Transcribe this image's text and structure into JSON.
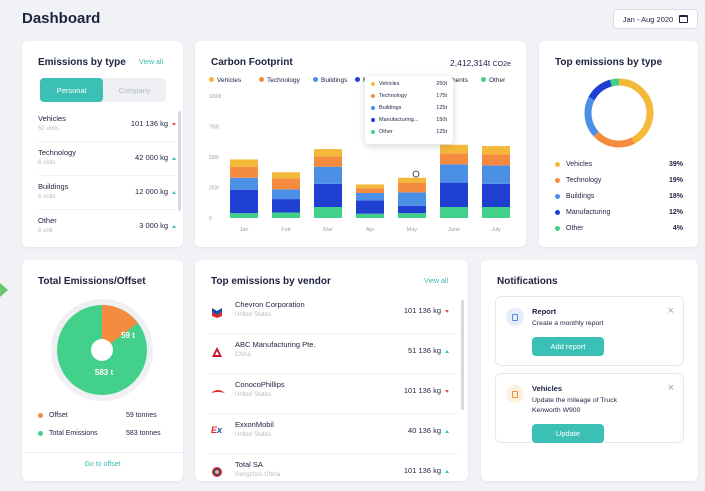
{
  "header": {
    "title": "Dashboard",
    "date_range": "Jan - Aug 2020"
  },
  "colors": {
    "vehicles": "#f5b93a",
    "technology": "#f58b3e",
    "buildings": "#4b8fe6",
    "manufacturing": "#1f3fd1",
    "other": "#43d08a",
    "accent": "#3cbfb4"
  },
  "emissions_by_type": {
    "title": "Emissions by type",
    "view_all": "View all",
    "tabs": [
      "Personal",
      "Company"
    ],
    "items": [
      {
        "name": "Vehicles",
        "units": "52 units",
        "value": "101 136 kg",
        "trend": "down"
      },
      {
        "name": "Technology",
        "units": "6 units",
        "value": "42 000 kg",
        "trend": "up"
      },
      {
        "name": "Buildings",
        "units": "6 units",
        "value": "12 000 kg",
        "trend": "up"
      },
      {
        "name": "Other",
        "units": "6 unit",
        "value": "3 000 kg",
        "trend": "up"
      }
    ]
  },
  "carbon_footprint": {
    "title": "Carbon Footprint",
    "total_value": "2,412,314t",
    "total_unit": "CO2e",
    "legend": [
      "Vehicles",
      "Technology",
      "Buildings",
      "Manufacturing",
      "Other"
    ],
    "legend_visible_tail": "hents",
    "tooltip": [
      {
        "name": "Vehicles",
        "value": "250t"
      },
      {
        "name": "Technology",
        "value": "175t"
      },
      {
        "name": "Buildings",
        "value": "125t"
      },
      {
        "name": "Manufacturing...",
        "value": "150t"
      },
      {
        "name": "Other",
        "value": "125t"
      }
    ]
  },
  "chart_data": {
    "type": "bar",
    "stacked": true,
    "categories": [
      "Jan",
      "Feb",
      "Mar",
      "Apr",
      "May",
      "June",
      "July"
    ],
    "yticks": [
      "1000t",
      "750t",
      "500t",
      "250t",
      "0"
    ],
    "ylim": [
      0,
      1000
    ],
    "series": [
      {
        "name": "Other",
        "values": [
          40,
          45,
          90,
          35,
          40,
          90,
          90
        ]
      },
      {
        "name": "Manufacturing",
        "values": [
          190,
          110,
          190,
          110,
          60,
          200,
          190
        ]
      },
      {
        "name": "Buildings",
        "values": [
          100,
          80,
          140,
          60,
          110,
          150,
          150
        ]
      },
      {
        "name": "Technology",
        "values": [
          90,
          90,
          85,
          40,
          80,
          90,
          90
        ]
      },
      {
        "name": "Vehicles",
        "values": [
          60,
          50,
          60,
          30,
          40,
          70,
          70
        ]
      }
    ]
  },
  "top_emissions_by_type": {
    "title": "Top emissions by type",
    "items": [
      {
        "name": "Vehicles",
        "pct": "39%",
        "value": 39
      },
      {
        "name": "Technology",
        "pct": "19%",
        "value": 19
      },
      {
        "name": "Buildings",
        "pct": "18%",
        "value": 18
      },
      {
        "name": "Manufacturing",
        "pct": "12%",
        "value": 12
      },
      {
        "name": "Other",
        "pct": "4%",
        "value": 4
      }
    ]
  },
  "total_emissions": {
    "title": "Total Emissions/Offset",
    "offset_label": "59 t",
    "total_label": "583 t",
    "offset_value": 59,
    "total_value": 583,
    "legend": [
      {
        "name": "Offset",
        "value": "59 tonnes"
      },
      {
        "name": "Total Emissions",
        "value": "583 tonnes"
      }
    ],
    "cta": "Go to offset"
  },
  "vendors": {
    "title": "Top emissions by vendor",
    "view_all": "View all",
    "items": [
      {
        "name": "Chevron Corporation",
        "country": "United States",
        "value": "101 136 kg",
        "trend": "down"
      },
      {
        "name": "ABC Manufacturing Pte.",
        "country": "China",
        "value": "51 136 kg",
        "trend": "up"
      },
      {
        "name": "ConocoPhillips",
        "country": "United States",
        "value": "101 136 kg",
        "trend": "down"
      },
      {
        "name": "ExxonMobil",
        "country": "United States",
        "value": "40 136 kg",
        "trend": "up"
      },
      {
        "name": "Total SA",
        "country": "Gongzhou China",
        "value": "101 136 kg",
        "trend": "up"
      }
    ]
  },
  "notifications": {
    "title": "Notifications",
    "items": [
      {
        "title": "Report",
        "text": "Create a monthly report",
        "button": "Add report"
      },
      {
        "title": "Vehicles",
        "text": "Update the mileage of Truck Kenworth W900",
        "button": "Update"
      }
    ]
  }
}
